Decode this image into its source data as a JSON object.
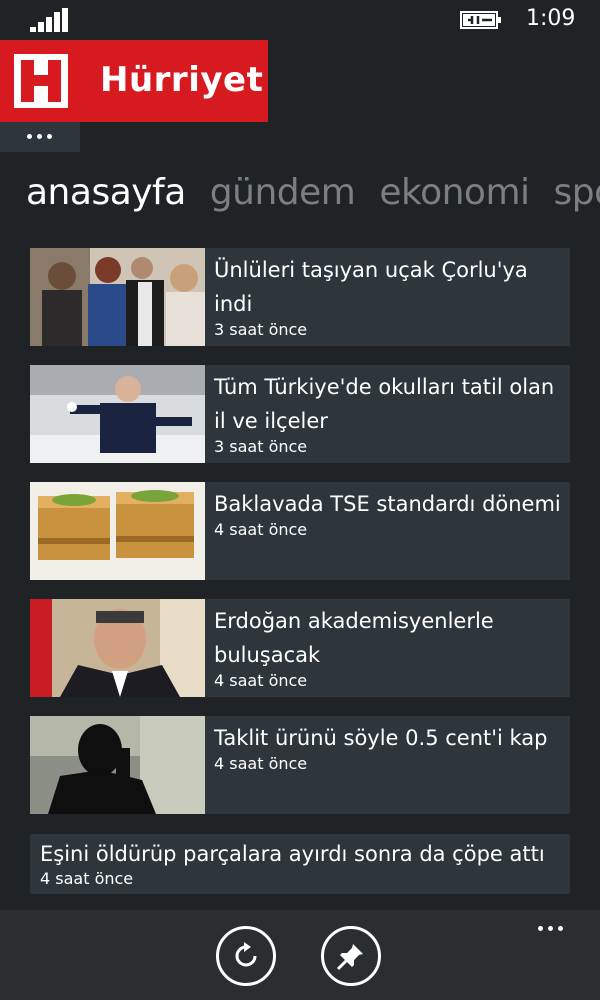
{
  "status_bar": {
    "time": "1:09",
    "icons": [
      "signal-icon",
      "battery-charging-icon"
    ]
  },
  "header": {
    "logo_letter": "H",
    "title": "Hürriyet",
    "brand_color": "#d71920",
    "more_icon": "ellipsis-icon"
  },
  "pivot": {
    "tabs": [
      {
        "label": "anasayfa",
        "active": true
      },
      {
        "label": "gündem",
        "active": false
      },
      {
        "label": "ekonomi",
        "active": false
      },
      {
        "label": "spor",
        "active": false
      }
    ]
  },
  "news": [
    {
      "headline": "Ünlüleri taşıyan uçak Çorlu'ya indi",
      "time": "3 saat önce",
      "image": "celebrities-photo"
    },
    {
      "headline": "Tüm Türkiye'de okulları tatil olan il ve ilçeler",
      "time": "3 saat önce",
      "image": "child-in-snow-photo"
    },
    {
      "headline": "Baklavada TSE standardı dönemi",
      "time": "4 saat önce",
      "image": "baklava-photo"
    },
    {
      "headline": "Erdoğan akademisyenlerle buluşacak",
      "time": "4 saat önce",
      "image": "erdogan-photo"
    },
    {
      "headline": "Taklit ürünü söyle 0.5 cent'i kap",
      "time": "4 saat önce",
      "image": "silhouette-on-phone-photo"
    },
    {
      "headline": "Eşini öldürüp parçalara ayırdı sonra da çöpe attı",
      "time": "4 saat önce"
    }
  ],
  "app_bar": {
    "buttons": [
      "refresh-icon",
      "pin-icon"
    ],
    "more_icon": "ellipsis-icon"
  }
}
